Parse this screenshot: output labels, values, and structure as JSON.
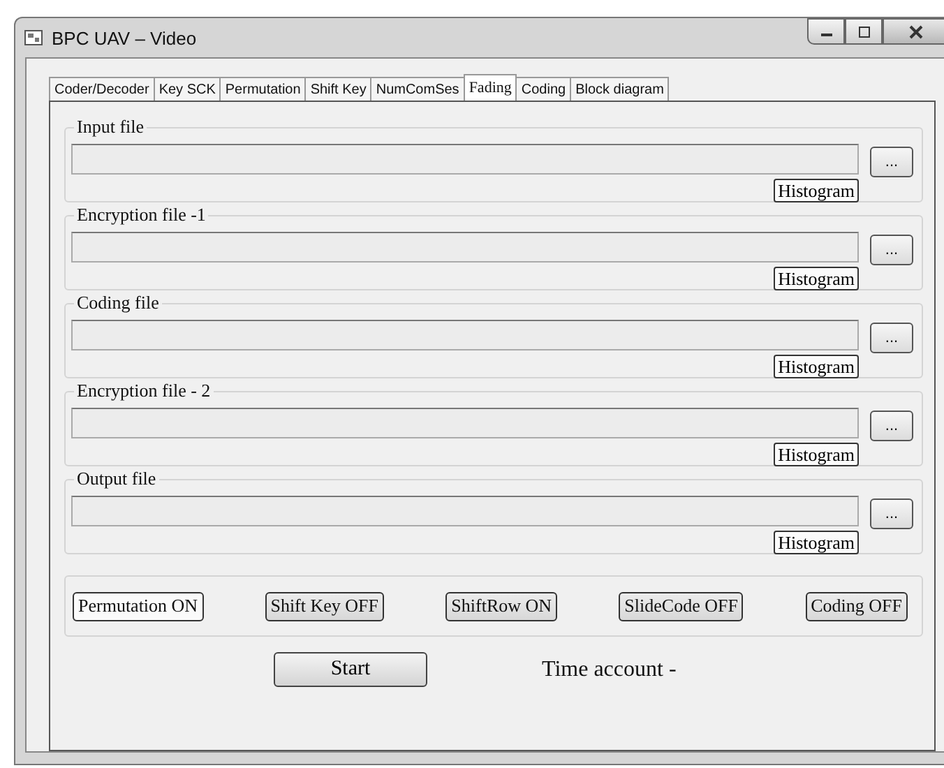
{
  "window": {
    "title": "BPC UAV – Video"
  },
  "tabs": [
    {
      "label": "Coder/Decoder",
      "selected": false
    },
    {
      "label": "Key SCK",
      "selected": false
    },
    {
      "label": "Permutation",
      "selected": false
    },
    {
      "label": "Shift Key",
      "selected": false
    },
    {
      "label": "NumComSes",
      "selected": false
    },
    {
      "label": "Fading",
      "selected": true
    },
    {
      "label": "Coding",
      "selected": false
    },
    {
      "label": "Block diagram",
      "selected": false
    }
  ],
  "file_groups": [
    {
      "title": "Input file",
      "browse": "...",
      "histogram": "Histogram"
    },
    {
      "title": "Encryption file -1",
      "browse": "...",
      "histogram": "Histogram"
    },
    {
      "title": "Coding file",
      "browse": "...",
      "histogram": "Histogram"
    },
    {
      "title": "Encryption file - 2",
      "browse": "...",
      "histogram": "Histogram"
    },
    {
      "title": "Output file",
      "browse": "...",
      "histogram": "Histogram"
    }
  ],
  "toggles": [
    {
      "label": "Permutation ON",
      "selected": true
    },
    {
      "label": "Shift Key OFF",
      "selected": false
    },
    {
      "label": "ShiftRow ON",
      "selected": false
    },
    {
      "label": "SlideCode OFF",
      "selected": false
    },
    {
      "label": "Coding OFF",
      "selected": false
    }
  ],
  "start_button": "Start",
  "time_label": "Time account -"
}
